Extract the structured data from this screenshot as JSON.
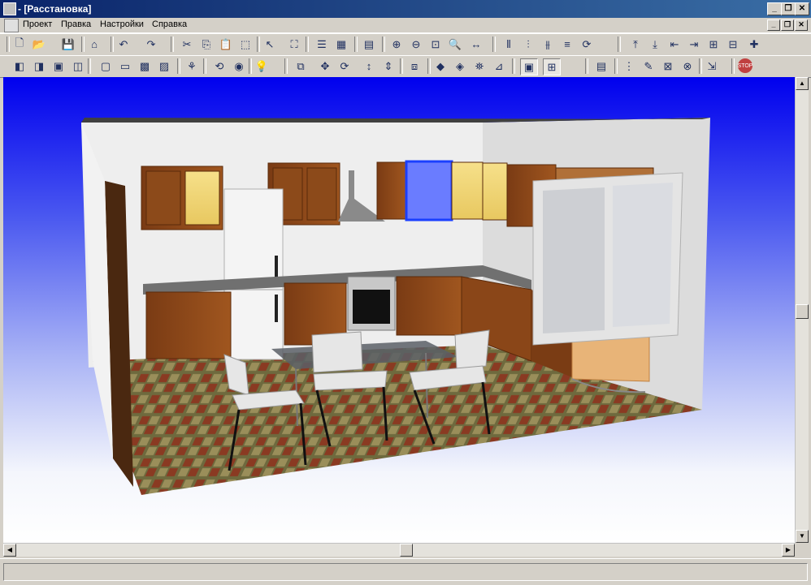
{
  "window": {
    "title": "- [Расстановка]",
    "controls": [
      "_",
      "❐",
      "✕"
    ]
  },
  "menu": {
    "items": [
      "Проект",
      "Правка",
      "Настройки",
      "Справка"
    ],
    "mdi_controls": [
      "_",
      "❐",
      "✕"
    ]
  },
  "toolbar1": {
    "icons": [
      "new-icon",
      "open-icon",
      "save-icon",
      "home-icon",
      "undo-icon",
      "redo-icon",
      "cut-icon",
      "copy-icon",
      "paste-icon",
      "select-icon",
      "pointer-icon",
      "fit-icon",
      "list-icon",
      "library-icon",
      "properties-icon",
      "zoom-in-icon",
      "zoom-out-icon",
      "zoom-window-icon",
      "zoom-all-icon",
      "measure-icon",
      "align-left-icon",
      "align-center-icon",
      "align-right-icon",
      "distribute-icon",
      "rotate-icon",
      "move-up-icon",
      "move-down-icon",
      "move-left-icon",
      "move-right-icon",
      "group-icon",
      "ungroup-icon",
      "add-icon"
    ],
    "glyphs": [
      "🗋",
      "📂",
      "💾",
      "⌂",
      "↶",
      "↷",
      "✂",
      "⎘",
      "📋",
      "⬚",
      "↖",
      "⛶",
      "☰",
      "▦",
      "▤",
      "⊕",
      "⊖",
      "⊡",
      "🔍",
      "↔",
      "⫴",
      "⫶",
      "⫵",
      "≡",
      "⟳",
      "⤒",
      "⤓",
      "⇤",
      "⇥",
      "⊞",
      "⊟",
      "✚"
    ]
  },
  "toolbar2": {
    "icons": [
      "view-front-icon",
      "view-top-icon",
      "view-side-icon",
      "view-iso-icon",
      "box-wire-icon",
      "box-icon",
      "box-solid-icon",
      "box-textured-icon",
      "camera-walk-icon",
      "orbit-icon",
      "camera-icon",
      "light-icon",
      "copy-object-icon",
      "move-icon",
      "rotate-icon",
      "move-vertical-icon",
      "move-depth-icon",
      "mirror-icon",
      "material-icon",
      "texture-icon",
      "render-icon",
      "measure-icon",
      "panel-view-icon",
      "scene-view-icon",
      "report-icon",
      "grid-icon",
      "paint-icon",
      "wire-icon",
      "hide-icon",
      "export-icon",
      "stop-icon"
    ],
    "glyphs": [
      "◧",
      "◨",
      "▣",
      "◫",
      "▢",
      "▭",
      "▩",
      "▨",
      "⚘",
      "⟲",
      "◉",
      "💡",
      "⧉",
      "✥",
      "⟳",
      "↕",
      "⇕",
      "⧈",
      "◆",
      "◈",
      "⛯",
      "⊿",
      "▣",
      "⊞",
      "▤",
      "⋮",
      "✎",
      "⊠",
      "⊗",
      "⇲",
      "STOP"
    ]
  },
  "viewport": {
    "scene": "kitchen-3d-layout"
  },
  "status": {
    "text": ""
  },
  "colors": {
    "title_bar": "#0a246a",
    "sky_top": "#0000ee",
    "cabinet": "#8b4513",
    "selection": "#1a3fff"
  }
}
